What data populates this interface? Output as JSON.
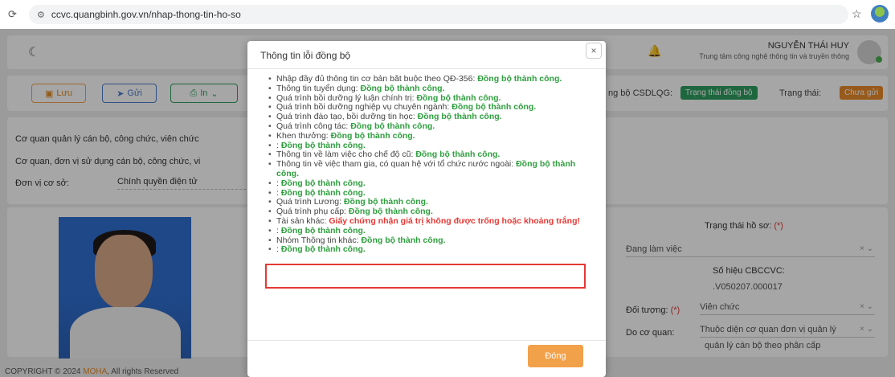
{
  "browser": {
    "url": "ccvc.quangbinh.gov.vn/nhap-thong-tin-ho-so"
  },
  "header": {
    "user_name": "NGUYỄN THÁI HUY",
    "user_org": "Trung tâm công nghệ thông tin và truyền thông"
  },
  "toolbar": {
    "save_label": "Lưu",
    "send_label": "Gửi",
    "print_label": "In",
    "sync_label": "ng bộ CSDLQG:",
    "sync_status": "Trạng thái đồng bộ",
    "status_label": "Trạng thái:",
    "status_value": "Chưa gửi"
  },
  "form": {
    "manage_agency_label": "Cơ quan quản lý cán bộ, công chức, viên chức",
    "using_agency_label": "Cơ quan, đơn vị sử dụng cán bộ, công chức, vi",
    "unit_label": "Đơn vị cơ sở:",
    "unit_value": "Chính quyền điện tử"
  },
  "profile": {
    "status_label": "Trạng thái hồ sơ:",
    "required": "(*)",
    "status_value": "Đang làm việc",
    "code_label": "Số hiệu CBCCVC:",
    "code_value": ".V050207.000017",
    "object_label": "Đối tượng:",
    "object_value": "Viên chức",
    "agency_label": "Do cơ quan:",
    "agency_value_1": "Thuộc diện cơ quan đơn vị quản lý",
    "agency_value_2": "quản lý cán bộ theo phân cấp"
  },
  "footer": {
    "copyright": "COPYRIGHT © 2024",
    "brand": "MOHA",
    "rights": ", All rights Reserved"
  },
  "modal": {
    "title": "Thông tin lỗi đồng bộ",
    "close_label": "Đóng",
    "items": [
      {
        "label": "Nhập đầy đủ thông tin cơ bản bắt buộc theo QĐ-356: ",
        "status": "Đồng bộ thành công.",
        "error": false
      },
      {
        "label": "Thông tin tuyển dụng: ",
        "status": "Đồng bộ thành công.",
        "error": false
      },
      {
        "label": "Quá trình bồi dưỡng lý luận chính trị: ",
        "status": "Đồng bộ thành công.",
        "error": false
      },
      {
        "label": "Quá trình bồi dưỡng nghiệp vụ chuyên ngành: ",
        "status": "Đồng bộ thành công.",
        "error": false
      },
      {
        "label": "Quá trình đào tạo, bồi dưỡng tin học: ",
        "status": "Đồng bộ thành công.",
        "error": false
      },
      {
        "label": "Quá trình công tác: ",
        "status": "Đồng bộ thành công.",
        "error": false
      },
      {
        "label": "Khen thưởng: ",
        "status": "Đồng bộ thành công.",
        "error": false
      },
      {
        "label": ": ",
        "status": "Đồng bộ thành công.",
        "error": false
      },
      {
        "label": "Thông tin về làm việc cho chế độ cũ: ",
        "status": "Đồng bộ thành công.",
        "error": false
      },
      {
        "label": "Thông tin về việc tham gia, có quan hệ với tổ chức nước ngoài: ",
        "status": "Đồng bộ thành công.",
        "error": false
      },
      {
        "label": ": ",
        "status": "Đồng bộ thành công.",
        "error": false
      },
      {
        "label": ": ",
        "status": "Đồng bộ thành công.",
        "error": false
      },
      {
        "label": "Quá trình Lương: ",
        "status": "Đồng bộ thành công.",
        "error": false
      },
      {
        "label": "Quá trình phụ cấp: ",
        "status": "Đồng bộ thành công.",
        "error": false
      },
      {
        "label": "Tài sản khác: ",
        "status": "Giấy chứng nhận giá trị không được trống hoặc khoảng trắng!",
        "error": true
      },
      {
        "label": ": ",
        "status": "Đồng bộ thành công.",
        "error": false
      },
      {
        "label": "Nhóm Thông tin khác: ",
        "status": "Đồng bộ thành công.",
        "error": false
      },
      {
        "label": ": ",
        "status": "Đồng bộ thành công.",
        "error": false
      }
    ]
  }
}
